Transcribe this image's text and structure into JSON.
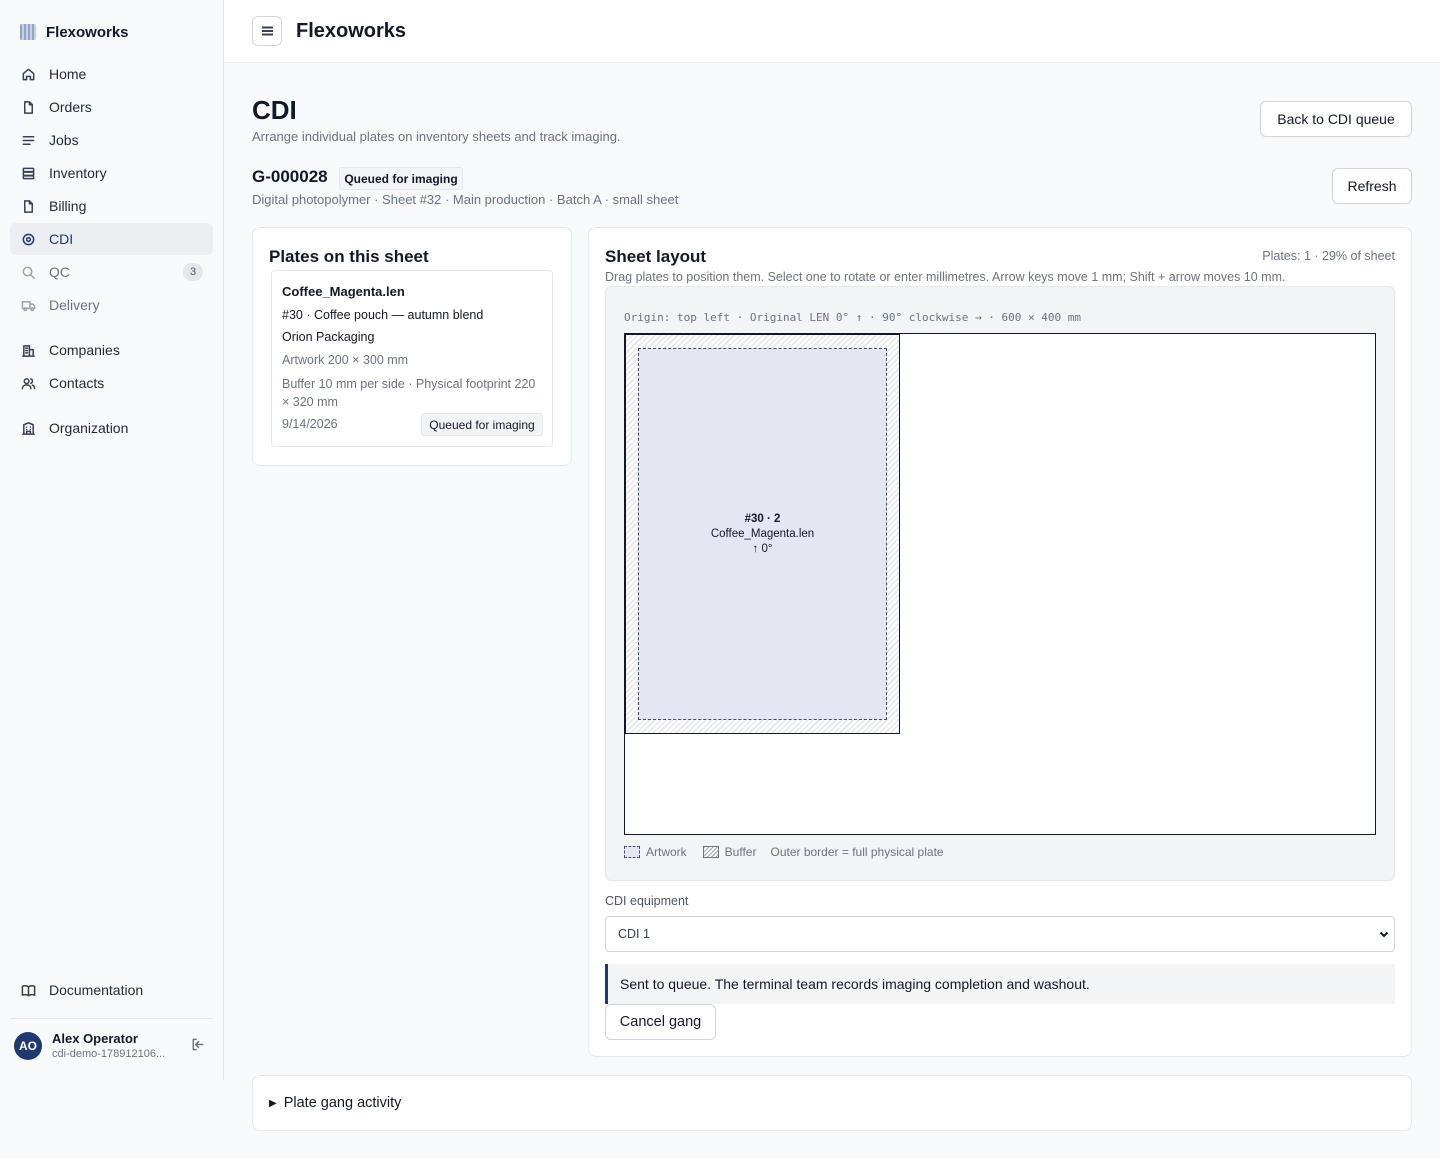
{
  "app": {
    "brand": "Flexoworks",
    "topbar_title": "Flexoworks"
  },
  "sidebar": {
    "items": [
      {
        "label": "Home",
        "icon": "home-icon"
      },
      {
        "label": "Orders",
        "icon": "file-icon"
      },
      {
        "label": "Jobs",
        "icon": "list-icon"
      },
      {
        "label": "Inventory",
        "icon": "inventory-icon"
      },
      {
        "label": "Billing",
        "icon": "file-icon"
      },
      {
        "label": "CDI",
        "icon": "target-icon",
        "active": true
      },
      {
        "label": "QC",
        "icon": "search-icon",
        "badge": "3"
      },
      {
        "label": "Delivery",
        "icon": "truck-icon"
      }
    ],
    "secondary": [
      {
        "label": "Companies",
        "icon": "building-icon"
      },
      {
        "label": "Contacts",
        "icon": "users-icon"
      }
    ],
    "tertiary": [
      {
        "label": "Organization",
        "icon": "organization-icon"
      }
    ],
    "documentation": "Documentation",
    "user": {
      "initials": "AO",
      "name": "Alex Operator",
      "email": "cdi-demo-178912106..."
    }
  },
  "page": {
    "title": "CDI",
    "subtitle": "Arrange individual plates on inventory sheets and track imaging.",
    "back_button": "Back to CDI queue",
    "refresh_button": "Refresh",
    "gang_id": "G-000028",
    "gang_status": "Queued for imaging",
    "gang_meta": "Digital photopolymer · Sheet #32 · Main production · Batch A · small sheet"
  },
  "plates_panel": {
    "title": "Plates on this sheet",
    "plates": [
      {
        "name": "Coffee_Magenta.len",
        "job": "#30 · Coffee pouch — autumn blend",
        "company": "Orion Packaging",
        "artwork": "Artwork 200 × 300 mm",
        "buffer": "Buffer 10 mm per side · Physical footprint 220 × 320 mm",
        "date": "9/14/2026",
        "status": "Queued for imaging"
      }
    ]
  },
  "layout_panel": {
    "title": "Sheet layout",
    "stats": "Plates: 1 · 29% of sheet",
    "hint": "Drag plates to position them. Select one to rotate or enter millimetres. Arrow keys move 1 mm; Shift + arrow moves 10 mm.",
    "origin": "Origin: top left · Original LEN 0° ↑ · 90° clockwise → · 600 × 400 mm",
    "plate_label": {
      "line1": "#30 · 2",
      "line2": "Coffee_Magenta.len",
      "line3": "↑ 0°"
    },
    "legend": {
      "artwork": "Artwork",
      "buffer": "Buffer",
      "outer": "Outer border = full physical plate"
    },
    "equipment_label": "CDI equipment",
    "equipment_value": "CDI 1",
    "notice": "Sent to queue. The terminal team records imaging completion and washout.",
    "cancel_button": "Cancel gang"
  },
  "activity": {
    "summary": "Plate gang activity"
  },
  "colors": {
    "accent": "#1e3a6e",
    "artwork_fill": "#e4e7f1"
  }
}
